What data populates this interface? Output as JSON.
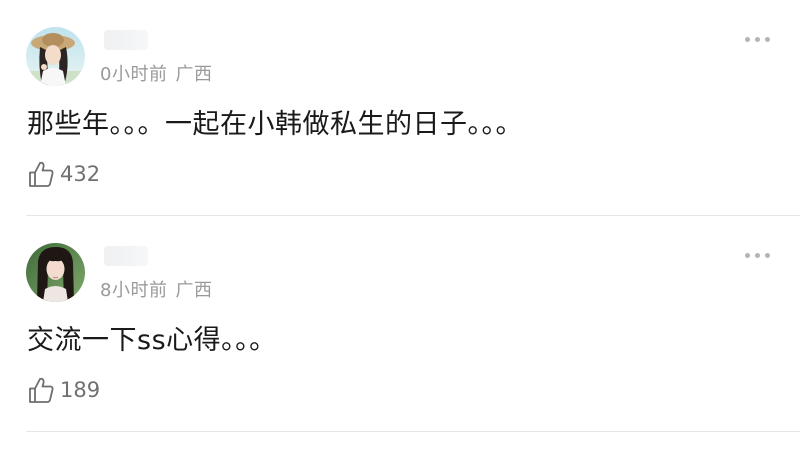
{
  "comments": [
    {
      "time": "0小时前",
      "location": "广西",
      "text": "那些年。。。一起在小韩做私生的日子。。。",
      "likes": "432"
    },
    {
      "time": "8小时前",
      "location": "广西",
      "text": "交流一下ss心得。。。",
      "likes": "189"
    }
  ],
  "icons": {
    "like": "thumbs-up-icon",
    "more": "more-horizontal-icon"
  },
  "colors": {
    "meta_text": "#9a9a9a",
    "like_count": "#707070",
    "divider": "#e6e6e6"
  }
}
